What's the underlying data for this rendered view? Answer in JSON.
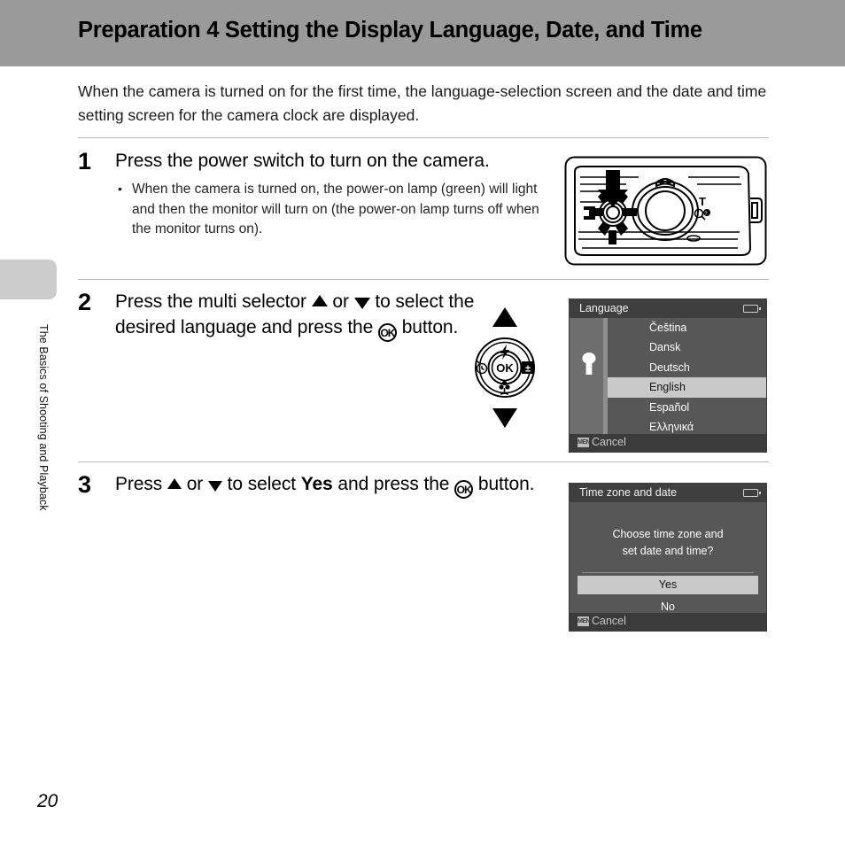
{
  "header": {
    "title": "Preparation 4 Setting the Display Language, Date, and Time"
  },
  "sidebar": {
    "chapter_label": "The Basics of Shooting and Playback"
  },
  "footer": {
    "page_number": "20"
  },
  "intro": {
    "text": "When the camera is turned on for the first time, the language-selection screen and the date and time setting screen for the camera clock are displayed."
  },
  "steps": [
    {
      "number": "1",
      "heading": "Press the power switch to turn on the camera.",
      "bullets": [
        "When the camera is turned on, the power-on lamp (green) will light and then the monitor will turn on (the power-on lamp turns off when the monitor turns on)."
      ]
    },
    {
      "number": "2",
      "heading_part1": "Press the multi selector",
      "heading_or": "or",
      "heading_part2": "to select the desired language and press the",
      "heading_part3": "button.",
      "ok_label": "OK"
    },
    {
      "number": "3",
      "heading_part1": "Press",
      "heading_or": "or",
      "heading_part2": "to select",
      "heading_bold": "Yes",
      "heading_part3": "and press the",
      "heading_part4": "button.",
      "ok_label": "OK"
    }
  ],
  "multi_selector": {
    "center_label": "OK",
    "icons": {
      "up": "flash-icon",
      "left": "self-timer-icon",
      "right": "exposure-compensation-icon",
      "down": "macro-icon"
    }
  },
  "camera_illustration": {
    "zoom_label": "T",
    "power_switch": "power-switch"
  },
  "language_screen": {
    "title": "Language",
    "menu_icon": "wrench-icon",
    "battery_icon": "battery-icon",
    "items": [
      {
        "label": "Čeština",
        "selected": false
      },
      {
        "label": "Dansk",
        "selected": false
      },
      {
        "label": "Deutsch",
        "selected": false
      },
      {
        "label": "English",
        "selected": true
      },
      {
        "label": "Español",
        "selected": false
      },
      {
        "label": "Ελληνικά",
        "selected": false
      }
    ],
    "footer_badge": "MENU",
    "footer_label": "Cancel"
  },
  "timezone_screen": {
    "title": "Time zone and date",
    "battery_icon": "battery-icon",
    "question_line1": "Choose time zone and",
    "question_line2": "set date and time?",
    "options": [
      {
        "label": "Yes",
        "selected": true
      },
      {
        "label": "No",
        "selected": false
      }
    ],
    "footer_badge": "MENU",
    "footer_label": "Cancel"
  },
  "colors": {
    "header_band": "#9a9a9a",
    "chapter_tab": "#cccccc",
    "lcd_background": "#575757",
    "lcd_titlebar": "#3f3f3f",
    "lcd_highlight": "#c9c9c9",
    "rule": "#b9b9b9"
  }
}
